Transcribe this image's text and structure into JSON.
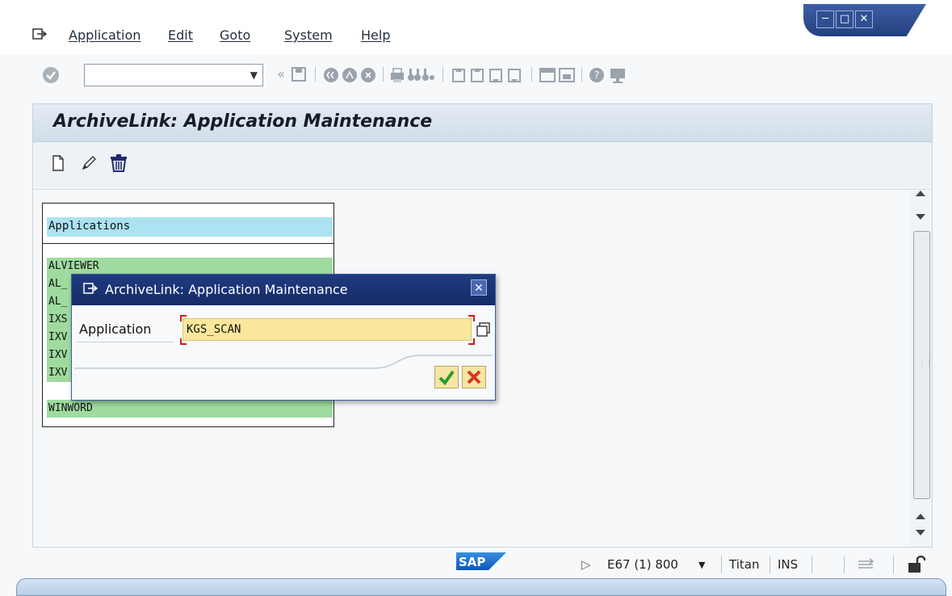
{
  "menubar": {
    "items": [
      "Application",
      "Edit",
      "Goto",
      "System",
      "Help"
    ]
  },
  "toolbar": {
    "command_field_value": "",
    "icons": [
      "check-icon",
      "back-icon",
      "save-icon",
      "back-green-icon",
      "exit-icon",
      "cancel-icon",
      "print-icon",
      "find-icon",
      "find-next-icon",
      "first-page-icon",
      "previous-page-icon",
      "next-page-icon",
      "last-page-icon",
      "new-session-icon",
      "shortcut-icon",
      "help-icon",
      "customize-icon"
    ]
  },
  "page": {
    "title": "ArchiveLink: Application Maintenance",
    "actions": [
      "create-icon",
      "edit-icon",
      "delete-icon"
    ]
  },
  "list": {
    "header": "Applications",
    "rows": [
      "ALVIEWER",
      "AL_",
      "AL_",
      "IXS",
      "IXV",
      "IXV",
      "IXV",
      "WINWORD"
    ]
  },
  "dialog": {
    "title": "ArchiveLink: Application Maintenance",
    "field_label": "Application",
    "field_value": "KGS_SCAN"
  },
  "status": {
    "system": "E67 (1) 800",
    "server": "Titan",
    "mode": "INS"
  },
  "colors": {
    "dialog_title": "#1b3370",
    "list_header": "#abe3f2",
    "list_row": "#9fdb9f",
    "input_bg": "#fbe79c"
  }
}
